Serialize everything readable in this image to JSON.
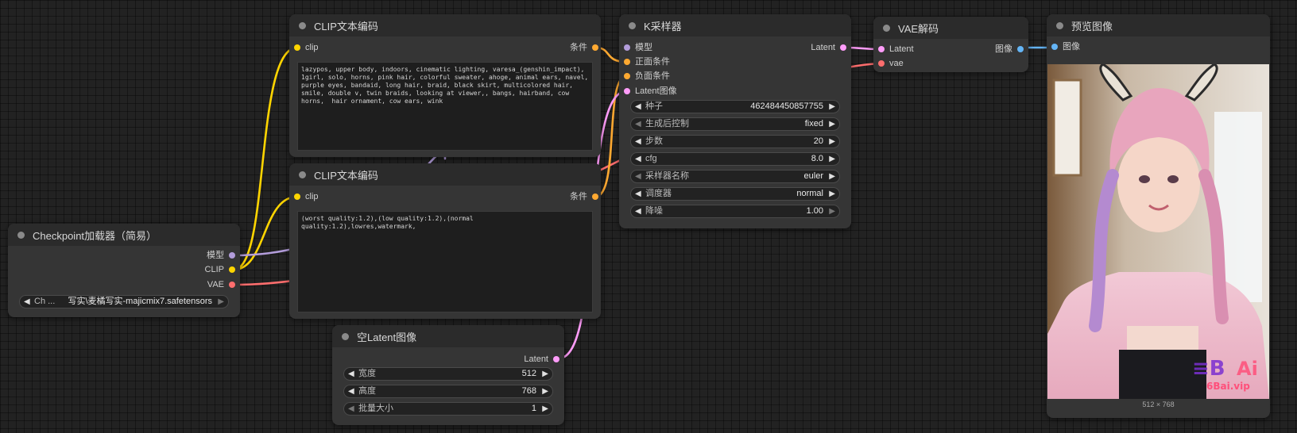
{
  "colors": {
    "clip": "#ffd500",
    "model": "#b39ddb",
    "vae": "#ff6e6e",
    "conditioning": "#ffa931",
    "latent": "#ff9cf9",
    "image": "#64b5f6"
  },
  "nodes": {
    "checkpoint": {
      "title": "Checkpoint加载器（简易）",
      "outputs": {
        "model": "模型",
        "clip": "CLIP",
        "vae": "VAE"
      },
      "widget": {
        "label": "Ch ...",
        "value": "写实\\麦橘写实-majicmix7.safetensors"
      }
    },
    "clip_pos": {
      "title": "CLIP文本编码",
      "input": "clip",
      "output": "条件",
      "text": "lazypos, upper body, indoors, cinematic lighting, varesa_(genshin_impact), 1girl, solo, horns, pink hair, colorful sweater, ahoge, animal ears, navel, purple eyes, bandaid, long hair, braid, black skirt, multicolored hair, smile, double v, twin braids, looking at viewer,, bangs, hairband, cow horns,  hair ornament, cow ears, wink"
    },
    "clip_neg": {
      "title": "CLIP文本编码",
      "input": "clip",
      "output": "条件",
      "text": "(worst quality:1.2),(low quality:1.2),(normal quality:1.2),lowres,watermark,"
    },
    "latent": {
      "title": "空Latent图像",
      "output": "Latent",
      "widgets": [
        {
          "label": "宽度",
          "value": "512"
        },
        {
          "label": "高度",
          "value": "768"
        },
        {
          "label": "批量大小",
          "value": "1"
        }
      ]
    },
    "ksampler": {
      "title": "K采样器",
      "inputs": {
        "model": "模型",
        "positive": "正面条件",
        "negative": "负面条件",
        "latent": "Latent图像"
      },
      "output": "Latent",
      "widgets": [
        {
          "label": "种子",
          "value": "462484450857755"
        },
        {
          "label": "生成后控制",
          "value": "fixed"
        },
        {
          "label": "步数",
          "value": "20"
        },
        {
          "label": "cfg",
          "value": "8.0"
        },
        {
          "label": "采样器名称",
          "value": "euler"
        },
        {
          "label": "调度器",
          "value": "normal"
        },
        {
          "label": "降噪",
          "value": "1.00"
        }
      ]
    },
    "vae_decode": {
      "title": "VAE解码",
      "inputs": {
        "latent": "Latent",
        "vae": "vae"
      },
      "output": "图像"
    },
    "preview": {
      "title": "预览图像",
      "input": "图像",
      "size": "512 × 768",
      "watermark_text": "6Bai.vip"
    }
  }
}
